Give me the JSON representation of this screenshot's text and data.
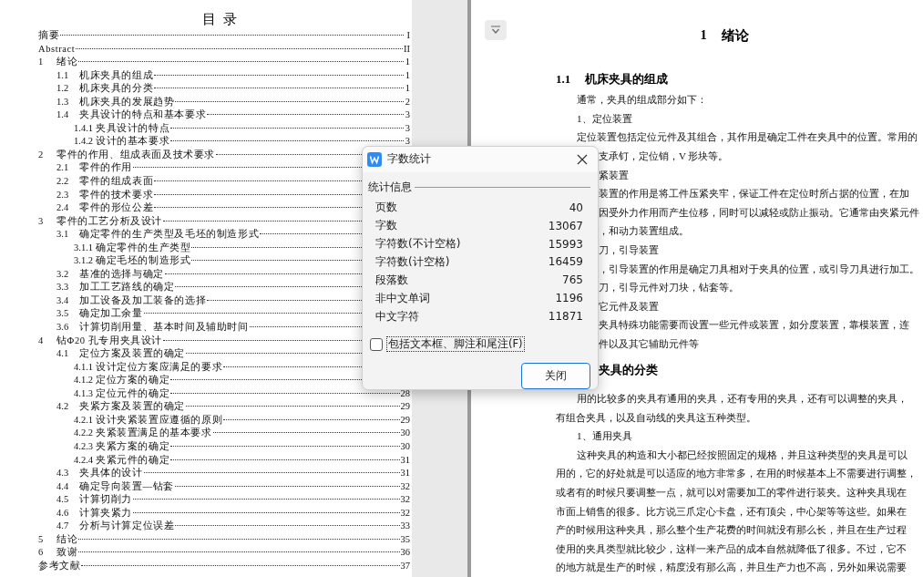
{
  "toc": {
    "title": "目  录",
    "entries": [
      {
        "title": "摘要",
        "page": "I"
      },
      {
        "title": "Abstract",
        "page": "II"
      },
      {
        "num": "1",
        "title": "绪论",
        "page": "1",
        "children": [
          {
            "num": "1.1",
            "title": "机床夹具的组成",
            "page": "1"
          },
          {
            "num": "1.2",
            "title": "机床夹具的分类",
            "page": "1"
          },
          {
            "num": "1.3",
            "title": "机床夹具的发展趋势",
            "page": "2"
          },
          {
            "num": "1.4",
            "title": "夹具设计的特点和基本要求",
            "page": "3",
            "children": [
              {
                "num": "1.4.1",
                "title": "夹具设计的特点",
                "page": "3"
              },
              {
                "num": "1.4.2",
                "title": "设计的基本要求",
                "page": "3"
              }
            ]
          }
        ]
      },
      {
        "num": "2",
        "title": "零件的作用、组成表面及技术要求",
        "children": [
          {
            "num": "2.1",
            "title": "零件的作用"
          },
          {
            "num": "2.2",
            "title": "零件的组成表面"
          },
          {
            "num": "2.3",
            "title": "零件的技术要求"
          },
          {
            "num": "2.4",
            "title": "零件的形位公差"
          }
        ]
      },
      {
        "num": "3",
        "title": "零件的工艺分析及设计",
        "children": [
          {
            "num": "3.1",
            "title": "确定零件的生产类型及毛坯的制造形式",
            "children": [
              {
                "num": "3.1.1",
                "title": "确定零件的生产类型"
              },
              {
                "num": "3.1.2",
                "title": "确定毛坯的制造形式"
              }
            ]
          },
          {
            "num": "3.2",
            "title": "基准的选择与确定"
          },
          {
            "num": "3.3",
            "title": "加工工艺路线的确定"
          },
          {
            "num": "3.4",
            "title": "加工设备及加工装备的选择"
          },
          {
            "num": "3.5",
            "title": "确定加工余量"
          },
          {
            "num": "3.6",
            "title": "计算切削用量、基本时间及辅助时间"
          }
        ]
      },
      {
        "num": "4",
        "title": "钻Φ20 孔专用夹具设计",
        "children": [
          {
            "num": "4.1",
            "title": "定位方案及装置的确定",
            "children": [
              {
                "num": "4.1.1",
                "title": "设计定位方案应满足的要求"
              },
              {
                "num": "4.1.2",
                "title": "定位方案的确定"
              },
              {
                "num": "4.1.3",
                "title": "定位元件的确定",
                "page": "28"
              }
            ]
          },
          {
            "num": "4.2",
            "title": "夹紧方案及装置的确定",
            "page": "29",
            "children": [
              {
                "num": "4.2.1",
                "title": "设计夹紧装置应遵循的原则",
                "page": "29"
              },
              {
                "num": "4.2.2",
                "title": "夹紧装置满足的基本要求",
                "page": "30"
              },
              {
                "num": "4.2.3",
                "title": "夹紧方案的确定",
                "page": "30"
              },
              {
                "num": "4.2.4",
                "title": "夹紧元件的确定",
                "page": "31"
              }
            ]
          },
          {
            "num": "4.3",
            "title": "夹具体的设计",
            "page": "31"
          },
          {
            "num": "4.4",
            "title": "确定导向装置—钻套",
            "page": "32"
          },
          {
            "num": "4.5",
            "title": "计算切削力",
            "page": "32"
          },
          {
            "num": "4.6",
            "title": "计算夹紧力",
            "page": "32"
          },
          {
            "num": "4.7",
            "title": "分析与计算定位误差",
            "page": "33"
          }
        ]
      },
      {
        "num": "5",
        "title": "结论",
        "page": "35"
      },
      {
        "num": "6",
        "title": "致谢",
        "page": "36"
      },
      {
        "title": "参考文献",
        "page": "37"
      }
    ]
  },
  "body": [
    {
      "kind": "chapter",
      "num": "1",
      "text": "绪论"
    },
    {
      "kind": "section",
      "num": "1.1",
      "text": "机床夹具的组成"
    },
    {
      "kind": "para",
      "text": "通常，夹具的组成部分如下："
    },
    {
      "kind": "para",
      "text": "1、定位装置"
    },
    {
      "kind": "para",
      "text": "定位装置包括定位元件及其组合，其作用是确定工件在夹具中的位置。常用的"
    },
    {
      "kind": "cut",
      "text": "支承钉，定位销，V 形块等。"
    },
    {
      "kind": "cut",
      "text": "紧装置"
    },
    {
      "kind": "cut",
      "text": "装置的作用是将工件压紧夹牢，保证工件在定位时所占据的位置，在加"
    },
    {
      "kind": "cut",
      "text": "因受外力作用而产生位移，同时可以减轻或防止振动。它通常由夹紧元件"
    },
    {
      "kind": "cut",
      "text": "，和动力装置组成。"
    },
    {
      "kind": "cut",
      "text": "刀，引导装置"
    },
    {
      "kind": "cut",
      "text": "，引导装置的作用是确定刀具相对于夹具的位置，或引导刀具进行加工。"
    },
    {
      "kind": "cut",
      "text": "刀，引导元件对刀块，钻套等。"
    },
    {
      "kind": "cut",
      "text": "它元件及装置"
    },
    {
      "kind": "cut",
      "text": "夹具特殊功能需要而设置一些元件或装置，如分度装置，靠模装置，连"
    },
    {
      "kind": "cut",
      "text": "件以及其它辅助元件等"
    },
    {
      "kind": "cut-section",
      "text": "夹具的分类"
    },
    {
      "kind": "para",
      "text": "用的比较多的夹具有通用的夹具，还有专用的夹具，还有可以调整的夹具，"
    },
    {
      "kind": "flush",
      "text": "有组合夹具，以及自动线的夹具这五种类型。"
    },
    {
      "kind": "para",
      "text": "1、通用夹具"
    },
    {
      "kind": "para",
      "text": "这种夹具的构造和大小都已经按照固定的规格，并且这种类型的夹具是可以"
    },
    {
      "kind": "flush",
      "text": "用的，它的好处就是可以适应的地方非常多，在用的时候基本上不需要进行调整，"
    },
    {
      "kind": "flush",
      "text": "或者有的时候只要调整一点，就可以对需要加工的零件进行装夹。这种夹具现在"
    },
    {
      "kind": "flush",
      "text": "市面上销售的很多。比方说三爪定心卡盘，还有顶尖，中心架等等这些。如果在"
    },
    {
      "kind": "flush",
      "text": "产的时候用这种夹具，那么整个生产花费的时间就没有那么长，并且在生产过程"
    },
    {
      "kind": "flush",
      "text": "使用的夹具类型就比较少，这样一来产品的成本自然就降低了很多。不过，它不"
    },
    {
      "kind": "flush",
      "text": "的地方就是生产的时候，精度没有那么高，并且生产力也不高，另外如果说需要"
    }
  ],
  "dialog": {
    "title": "字数统计",
    "group": "统计信息",
    "stats": [
      {
        "label": "页数",
        "value": "40"
      },
      {
        "label": "字数",
        "value": "13067"
      },
      {
        "label": "字符数(不计空格)",
        "value": "15993"
      },
      {
        "label": "字符数(计空格)",
        "value": "16459"
      },
      {
        "label": "段落数",
        "value": "765"
      },
      {
        "label": "非中文单词",
        "value": "1196"
      },
      {
        "label": "中文字符",
        "value": "11871"
      }
    ],
    "option": {
      "label": "包括文本框、脚注和尾注(F)",
      "checked": false
    },
    "button": "关闭"
  }
}
